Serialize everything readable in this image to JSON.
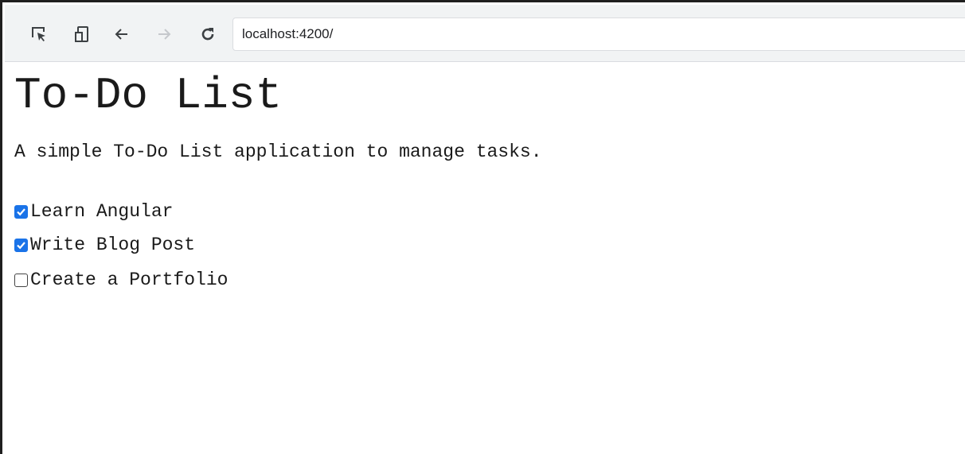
{
  "browser": {
    "url": "localhost:4200/",
    "icons": [
      "inspect-icon",
      "device-toggle-icon",
      "back-arrow-icon",
      "forward-arrow-icon",
      "reload-icon"
    ]
  },
  "page": {
    "title": "To-Do List",
    "description": "A simple To-Do List application to manage tasks.",
    "tasks": [
      {
        "label": "Learn Angular",
        "done": true
      },
      {
        "label": "Write Blog Post",
        "done": true
      },
      {
        "label": "Create a Portfolio",
        "done": false
      }
    ]
  },
  "colors": {
    "checkbox_checked": "#1a73e8",
    "toolbar_background": "#f1f3f4"
  }
}
